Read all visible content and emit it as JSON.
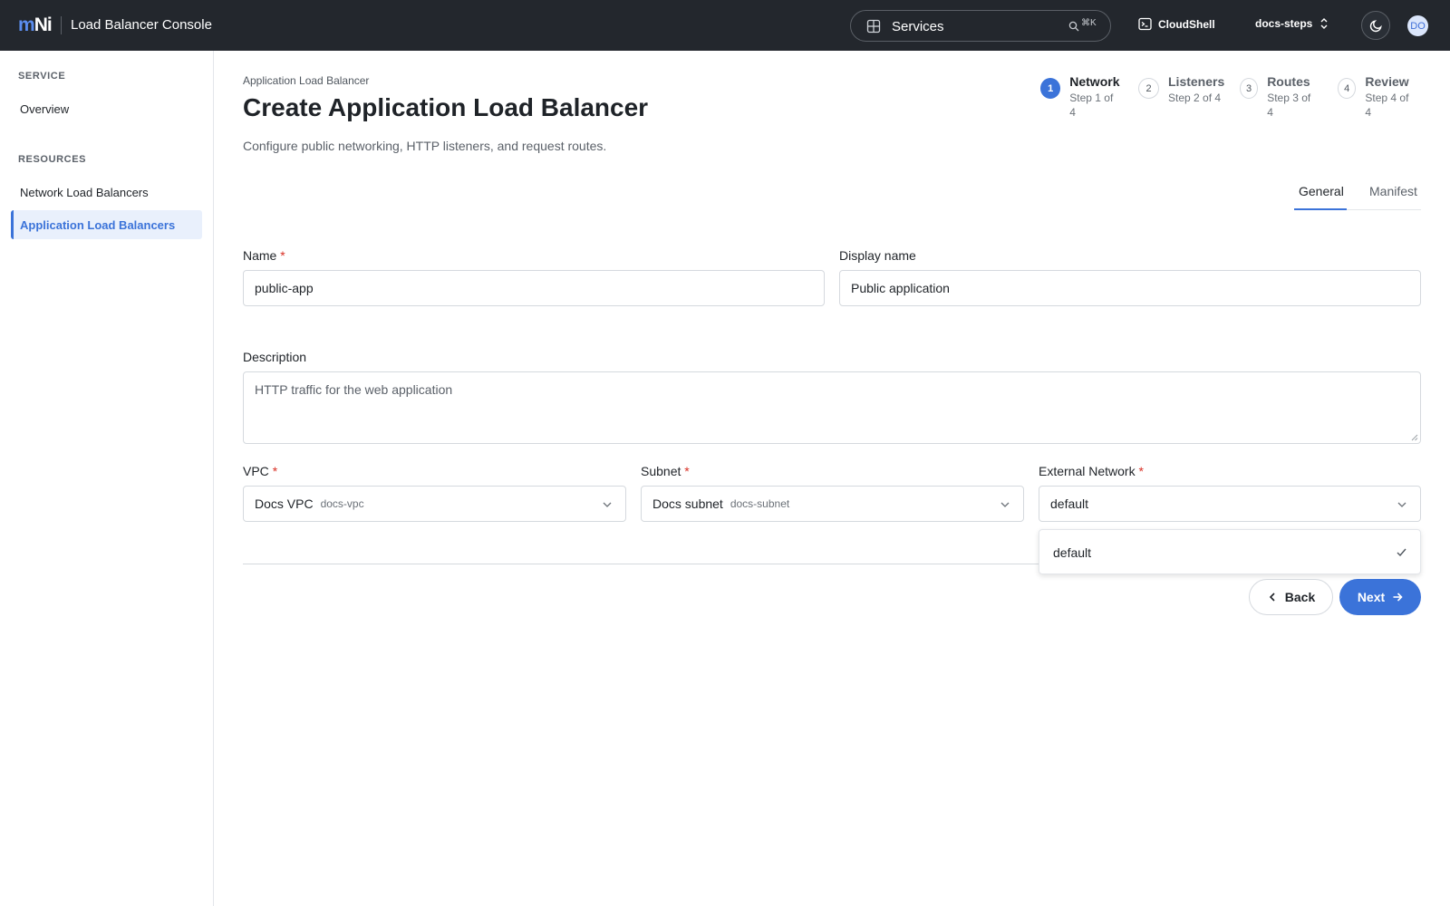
{
  "topbar": {
    "logo_m": "m",
    "logo_ni": "Ni",
    "console_title": "Load Balancer Console",
    "search_label": "Services",
    "search_shortcut": "⌘K",
    "cloudshell_label": "CloudShell",
    "project_label": "docs-steps",
    "avatar_initials": "DO",
    "icons": [
      "grid-icon",
      "search-icon",
      "terminal-icon",
      "chevron-updown-icon",
      "moon-icon"
    ]
  },
  "sidebar": {
    "section_service": "SERVICE",
    "overview": "Overview",
    "section_resources": "RESOURCES",
    "items": [
      {
        "label": "Network Load Balancers",
        "active": false
      },
      {
        "label": "Application Load Balancers",
        "active": true
      }
    ]
  },
  "page": {
    "breadcrumb": "Application Load Balancer",
    "title": "Create Application Load Balancer",
    "description": "Configure public networking, HTTP listeners, and request routes."
  },
  "steps": [
    {
      "num": "1",
      "title": "Network",
      "sub": "Step 1 of 4",
      "active": true
    },
    {
      "num": "2",
      "title": "Listeners",
      "sub": "Step 2 of 4",
      "active": false
    },
    {
      "num": "3",
      "title": "Routes",
      "sub": "Step 3 of 4",
      "active": false
    },
    {
      "num": "4",
      "title": "Review",
      "sub": "Step 4 of 4",
      "active": false
    }
  ],
  "tabs": {
    "general": "General",
    "manifest": "Manifest",
    "active": "General"
  },
  "form": {
    "name_label": "Name",
    "name_value": "public-app",
    "display_name_label": "Display name",
    "display_name_value": "Public application",
    "description_label": "Description",
    "description_value": "HTTP traffic for the web application",
    "required_mark": "*",
    "vpc_label": "VPC",
    "vpc_value": "Docs VPC",
    "vpc_sub": "docs-vpc",
    "subnet_label": "Subnet",
    "subnet_value": "Docs subnet",
    "subnet_sub": "docs-subnet",
    "external_network_label": "External Network",
    "external_network_value": "default",
    "external_network_options": [
      "default"
    ]
  },
  "buttons": {
    "back": "Back",
    "next": "Next"
  },
  "colors": {
    "topbar_bg": "#23272d",
    "accent": "#3b73d9",
    "required": "#d93025"
  }
}
